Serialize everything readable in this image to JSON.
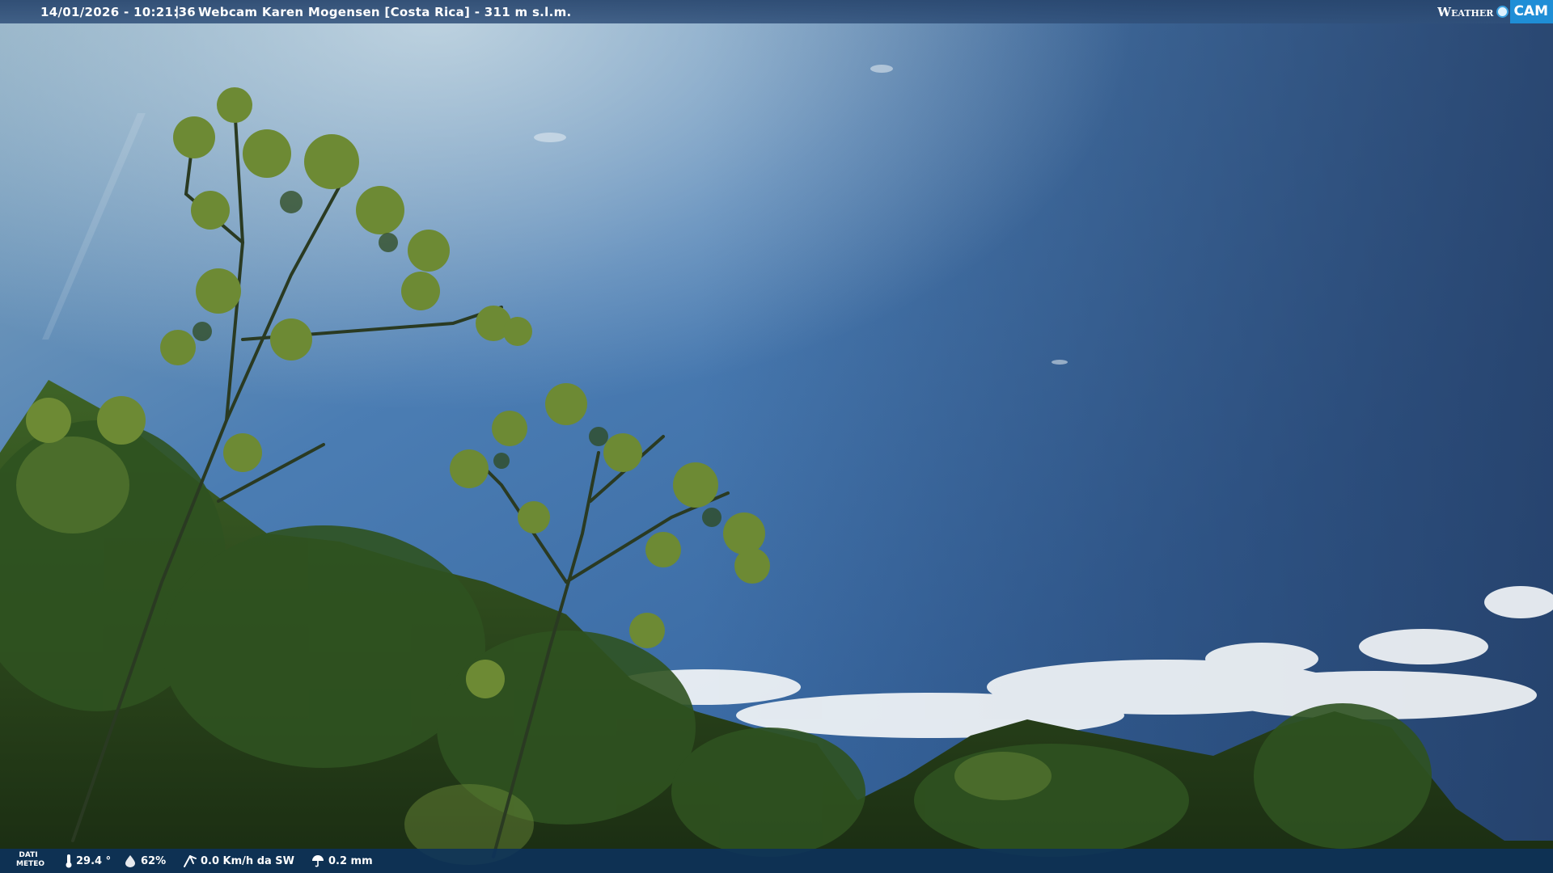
{
  "header": {
    "timestamp": "14/01/2026 - 10:21:36",
    "separator": "|",
    "camera_title": "Webcam Karen Mogensen [Costa Rica] - 311 m s.l.m."
  },
  "logo": {
    "word": "Weather",
    "cam": "CAM"
  },
  "weather": {
    "label_line1": "DATI",
    "label_line2": "METEO",
    "temperature": "29.4 °",
    "humidity": "62%",
    "wind": "0.0 Km/h da SW",
    "rain": "0.2 mm"
  },
  "colors": {
    "sky_top": "#7fa2bb",
    "sky_mid": "#3f6fa6",
    "sky_dark": "#2a426a",
    "foliage": "#2c4a1c",
    "bar": "#0c325c",
    "logo_accent": "#1f8ed6"
  }
}
